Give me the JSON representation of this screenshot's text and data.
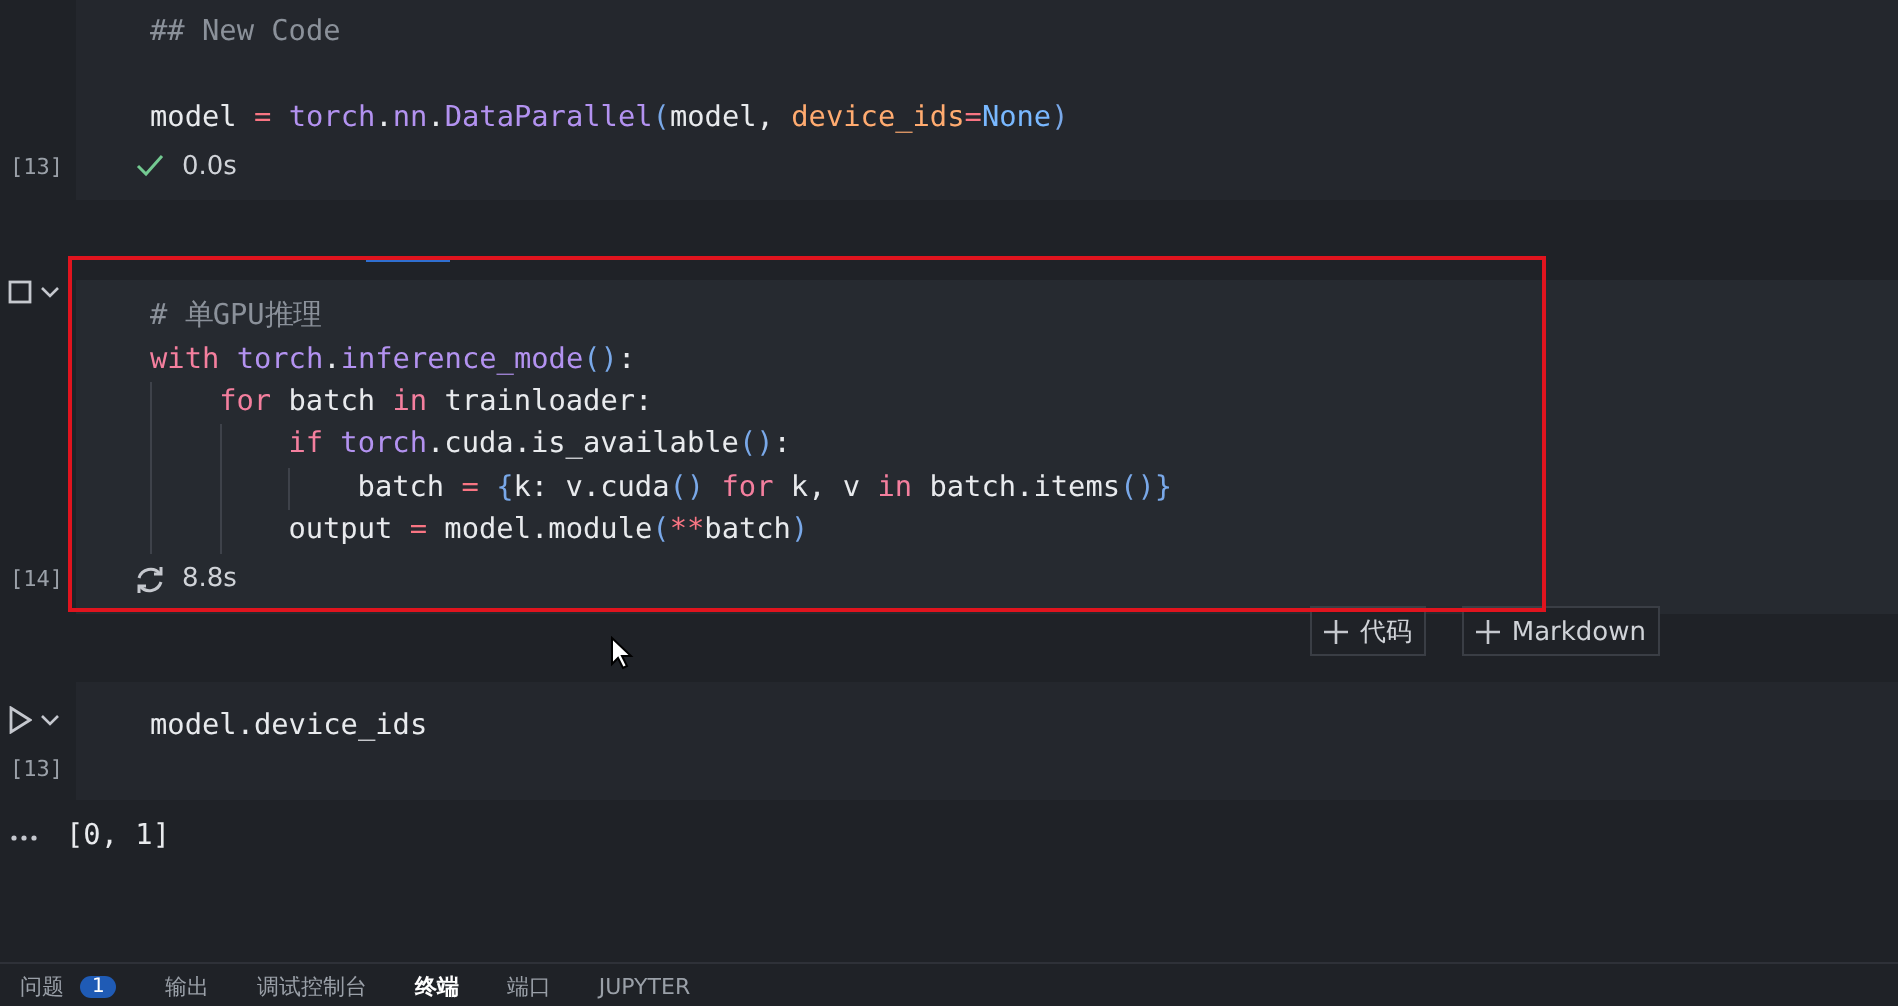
{
  "cells": [
    {
      "lines": [
        {
          "kind": "code",
          "tokens": [
            {
              "kind": "comment",
              "text": "## New Code"
            }
          ]
        },
        {
          "kind": "blank"
        },
        {
          "kind": "code",
          "tokens": [
            {
              "kind": "variable",
              "text": "model"
            },
            {
              "kind": "operator",
              "text": " = "
            },
            {
              "kind": "module",
              "text": "torch"
            },
            {
              "kind": "variable",
              "text": "."
            },
            {
              "kind": "module",
              "text": "nn"
            },
            {
              "kind": "variable",
              "text": "."
            },
            {
              "kind": "function",
              "text": "DataParallel"
            },
            {
              "kind": "bracket",
              "text": "("
            },
            {
              "kind": "variable",
              "text": "model, "
            },
            {
              "kind": "parameter",
              "text": "device_ids"
            },
            {
              "kind": "operator",
              "text": "="
            },
            {
              "kind": "constant",
              "text": "None"
            },
            {
              "kind": "bracket",
              "text": ")"
            }
          ]
        }
      ],
      "exec_count": "[13]",
      "status_icon": {
        "kind": "success"
      },
      "time": "0.0s",
      "selected": false
    },
    {
      "run_control": {
        "kind": "stop"
      },
      "lines": [
        {
          "kind": "code",
          "tokens": [
            {
              "kind": "comment",
              "text": "# 单GPU推理"
            }
          ]
        },
        {
          "kind": "code",
          "tokens": [
            {
              "kind": "keyword",
              "text": "with"
            },
            {
              "kind": "module",
              "text": " torch"
            },
            {
              "kind": "variable",
              "text": "."
            },
            {
              "kind": "function",
              "text": "inference_mode"
            },
            {
              "kind": "bracket",
              "text": "()"
            },
            {
              "kind": "variable",
              "text": ":"
            }
          ]
        },
        {
          "kind": "code",
          "tokens": [
            {
              "kind": "keyword",
              "text": "    for"
            },
            {
              "kind": "variable",
              "text": " batch "
            },
            {
              "kind": "keyword",
              "text": "in"
            },
            {
              "kind": "variable",
              "text": " trainloader:"
            }
          ]
        },
        {
          "kind": "code",
          "tokens": [
            {
              "kind": "keyword",
              "text": "        if"
            },
            {
              "kind": "module",
              "text": " torch"
            },
            {
              "kind": "variable",
              "text": ".cuda.is_available"
            },
            {
              "kind": "bracket",
              "text": "()"
            },
            {
              "kind": "variable",
              "text": ":"
            }
          ]
        },
        {
          "kind": "code",
          "tokens": [
            {
              "kind": "variable",
              "text": "            batch "
            },
            {
              "kind": "operator",
              "text": "="
            },
            {
              "kind": "bracket",
              "text": " {"
            },
            {
              "kind": "variable",
              "text": "k: v.cuda"
            },
            {
              "kind": "bracket",
              "text": "() "
            },
            {
              "kind": "keyword",
              "text": "for"
            },
            {
              "kind": "variable",
              "text": " k, v "
            },
            {
              "kind": "keyword",
              "text": "in"
            },
            {
              "kind": "variable",
              "text": " batch.items"
            },
            {
              "kind": "bracket",
              "text": "()}"
            }
          ]
        },
        {
          "kind": "code",
          "tokens": [
            {
              "kind": "variable",
              "text": "        output "
            },
            {
              "kind": "operator",
              "text": "="
            },
            {
              "kind": "variable",
              "text": " model.module"
            },
            {
              "kind": "bracket",
              "text": "("
            },
            {
              "kind": "operator",
              "text": "**"
            },
            {
              "kind": "variable",
              "text": "batch"
            },
            {
              "kind": "bracket",
              "text": ")"
            }
          ]
        }
      ],
      "exec_count": "[14]",
      "status_icon": {
        "kind": "running"
      },
      "time": "8.8s",
      "selected": true
    },
    {
      "run_control": {
        "kind": "run"
      },
      "lines": [
        {
          "kind": "code",
          "tokens": [
            {
              "kind": "variable",
              "text": "model.device_ids"
            }
          ]
        }
      ],
      "exec_count": "[13]",
      "output": "[0, 1]",
      "selected": false
    }
  ],
  "insert_buttons": [
    "代码",
    "Markdown"
  ],
  "panel_tabs": [
    {
      "label": "问题",
      "badge": "1",
      "selected": false
    },
    {
      "label": "输出",
      "selected": false
    },
    {
      "label": "调试控制台",
      "selected": false
    },
    {
      "label": "终端",
      "selected": true
    },
    {
      "label": "端口",
      "selected": false
    },
    {
      "label": "JUPYTER",
      "selected": false
    }
  ]
}
